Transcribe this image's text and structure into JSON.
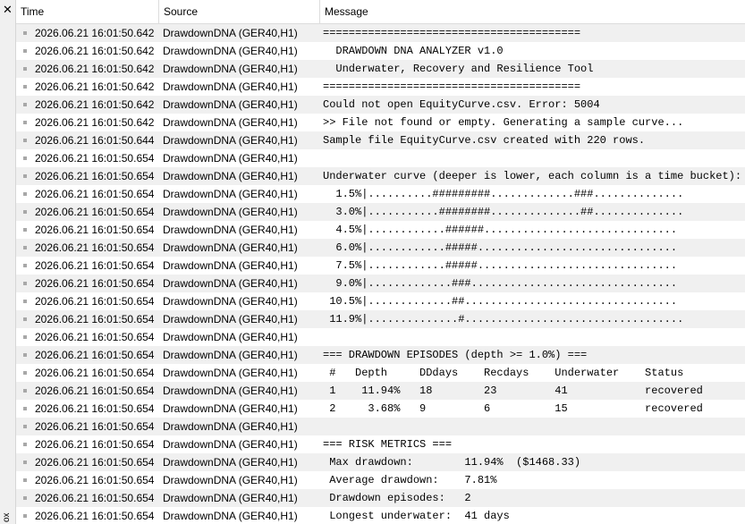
{
  "panel": {
    "side_label": "ox"
  },
  "columns": {
    "time": "Time",
    "source": "Source",
    "message": "Message"
  },
  "rows": [
    {
      "time": "2026.06.21 16:01:50.642",
      "source": "DrawdownDNA (GER40,H1)",
      "message": "========================================"
    },
    {
      "time": "2026.06.21 16:01:50.642",
      "source": "DrawdownDNA (GER40,H1)",
      "message": "  DRAWDOWN DNA ANALYZER v1.0"
    },
    {
      "time": "2026.06.21 16:01:50.642",
      "source": "DrawdownDNA (GER40,H1)",
      "message": "  Underwater, Recovery and Resilience Tool"
    },
    {
      "time": "2026.06.21 16:01:50.642",
      "source": "DrawdownDNA (GER40,H1)",
      "message": "========================================"
    },
    {
      "time": "2026.06.21 16:01:50.642",
      "source": "DrawdownDNA (GER40,H1)",
      "message": "Could not open EquityCurve.csv. Error: 5004"
    },
    {
      "time": "2026.06.21 16:01:50.642",
      "source": "DrawdownDNA (GER40,H1)",
      "message": ">> File not found or empty. Generating a sample curve..."
    },
    {
      "time": "2026.06.21 16:01:50.644",
      "source": "DrawdownDNA (GER40,H1)",
      "message": "Sample file EquityCurve.csv created with 220 rows."
    },
    {
      "time": "2026.06.21 16:01:50.654",
      "source": "DrawdownDNA (GER40,H1)",
      "message": ""
    },
    {
      "time": "2026.06.21 16:01:50.654",
      "source": "DrawdownDNA (GER40,H1)",
      "message": "Underwater curve (deeper is lower, each column is a time bucket):"
    },
    {
      "time": "2026.06.21 16:01:50.654",
      "source": "DrawdownDNA (GER40,H1)",
      "message": "  1.5%|..........#########.............###.............."
    },
    {
      "time": "2026.06.21 16:01:50.654",
      "source": "DrawdownDNA (GER40,H1)",
      "message": "  3.0%|...........########..............##.............."
    },
    {
      "time": "2026.06.21 16:01:50.654",
      "source": "DrawdownDNA (GER40,H1)",
      "message": "  4.5%|............######.............................."
    },
    {
      "time": "2026.06.21 16:01:50.654",
      "source": "DrawdownDNA (GER40,H1)",
      "message": "  6.0%|............#####..............................."
    },
    {
      "time": "2026.06.21 16:01:50.654",
      "source": "DrawdownDNA (GER40,H1)",
      "message": "  7.5%|............#####..............................."
    },
    {
      "time": "2026.06.21 16:01:50.654",
      "source": "DrawdownDNA (GER40,H1)",
      "message": "  9.0%|.............###................................"
    },
    {
      "time": "2026.06.21 16:01:50.654",
      "source": "DrawdownDNA (GER40,H1)",
      "message": " 10.5%|.............##................................."
    },
    {
      "time": "2026.06.21 16:01:50.654",
      "source": "DrawdownDNA (GER40,H1)",
      "message": " 11.9%|..............#.................................."
    },
    {
      "time": "2026.06.21 16:01:50.654",
      "source": "DrawdownDNA (GER40,H1)",
      "message": ""
    },
    {
      "time": "2026.06.21 16:01:50.654",
      "source": "DrawdownDNA (GER40,H1)",
      "message": "=== DRAWDOWN EPISODES (depth >= 1.0%) ==="
    },
    {
      "time": "2026.06.21 16:01:50.654",
      "source": "DrawdownDNA (GER40,H1)",
      "message": " #   Depth     DDdays    Recdays    Underwater    Status"
    },
    {
      "time": "2026.06.21 16:01:50.654",
      "source": "DrawdownDNA (GER40,H1)",
      "message": " 1    11.94%   18        23         41            recovered"
    },
    {
      "time": "2026.06.21 16:01:50.654",
      "source": "DrawdownDNA (GER40,H1)",
      "message": " 2     3.68%   9         6          15            recovered"
    },
    {
      "time": "2026.06.21 16:01:50.654",
      "source": "DrawdownDNA (GER40,H1)",
      "message": ""
    },
    {
      "time": "2026.06.21 16:01:50.654",
      "source": "DrawdownDNA (GER40,H1)",
      "message": "=== RISK METRICS ==="
    },
    {
      "time": "2026.06.21 16:01:50.654",
      "source": "DrawdownDNA (GER40,H1)",
      "message": " Max drawdown:        11.94%  ($1468.33)"
    },
    {
      "time": "2026.06.21 16:01:50.654",
      "source": "DrawdownDNA (GER40,H1)",
      "message": " Average drawdown:    7.81%"
    },
    {
      "time": "2026.06.21 16:01:50.654",
      "source": "DrawdownDNA (GER40,H1)",
      "message": " Drawdown episodes:   2"
    },
    {
      "time": "2026.06.21 16:01:50.654",
      "source": "DrawdownDNA (GER40,H1)",
      "message": " Longest underwater:  41 days"
    }
  ]
}
